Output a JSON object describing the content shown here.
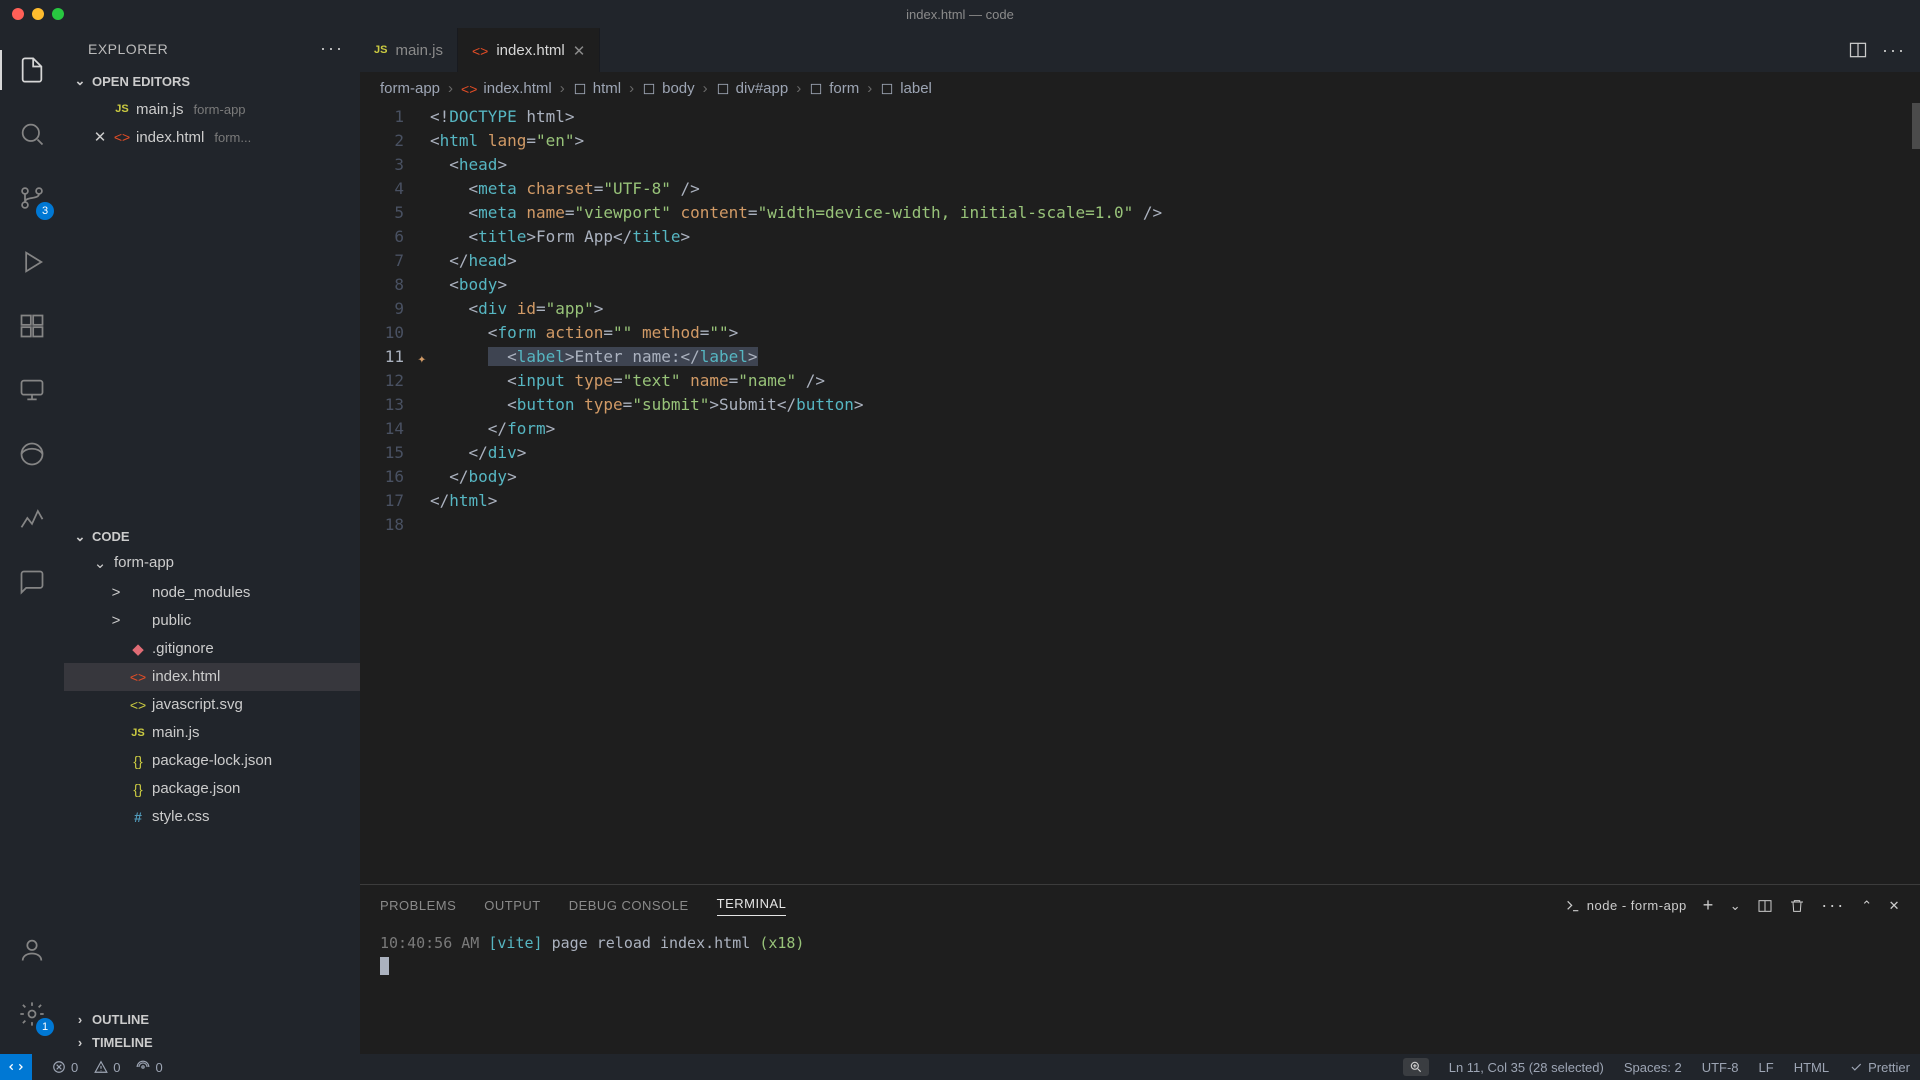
{
  "titlebar": {
    "title": "index.html — code"
  },
  "activity": {
    "scm_badge": "3",
    "accounts_badge": "1"
  },
  "sidebar": {
    "title": "EXPLORER",
    "sections": {
      "openEditors": "OPEN EDITORS",
      "workspace": "CODE",
      "outline": "OUTLINE",
      "timeline": "TIMELINE"
    },
    "openEditors": [
      {
        "icon": "js",
        "name": "main.js",
        "sub": "form-app"
      },
      {
        "icon": "html",
        "name": "index.html",
        "sub": "form...",
        "dirty": true
      }
    ],
    "folder": "form-app",
    "files": [
      {
        "chev": ">",
        "icon": "",
        "name": "node_modules",
        "depth": 2
      },
      {
        "chev": ">",
        "icon": "",
        "name": "public",
        "depth": 2
      },
      {
        "chev": "",
        "icon": "git",
        "name": ".gitignore",
        "depth": 2
      },
      {
        "chev": "",
        "icon": "html",
        "name": "index.html",
        "depth": 2,
        "selected": true
      },
      {
        "chev": "",
        "icon": "svg",
        "name": "javascript.svg",
        "depth": 2
      },
      {
        "chev": "",
        "icon": "js",
        "name": "main.js",
        "depth": 2
      },
      {
        "chev": "",
        "icon": "json",
        "name": "package-lock.json",
        "depth": 2
      },
      {
        "chev": "",
        "icon": "json",
        "name": "package.json",
        "depth": 2
      },
      {
        "chev": "",
        "icon": "css",
        "name": "style.css",
        "depth": 2
      }
    ]
  },
  "tabs": [
    {
      "icon": "js",
      "label": "main.js",
      "active": false
    },
    {
      "icon": "html",
      "label": "index.html",
      "active": true
    }
  ],
  "breadcrumbs": [
    "form-app",
    "index.html",
    "html",
    "body",
    "div#app",
    "form",
    "label"
  ],
  "code": {
    "lines": [
      {
        "n": 1,
        "html": "<span class='tok-punc'>&lt;!</span><span class='tok-doctype'>DOCTYPE</span> <span class='tok-doctype2'>html</span><span class='tok-punc'>&gt;</span>"
      },
      {
        "n": 2,
        "html": "<span class='tok-punc'>&lt;</span><span class='tok-tag'>html</span> <span class='tok-attr'>lang</span><span class='tok-punc'>=</span><span class='tok-str'>\"en\"</span><span class='tok-punc'>&gt;</span>"
      },
      {
        "n": 3,
        "html": "  <span class='tok-punc'>&lt;</span><span class='tok-tag'>head</span><span class='tok-punc'>&gt;</span>"
      },
      {
        "n": 4,
        "html": "    <span class='tok-punc'>&lt;</span><span class='tok-tag'>meta</span> <span class='tok-attr'>charset</span><span class='tok-punc'>=</span><span class='tok-str'>\"UTF-8\"</span> <span class='tok-punc'>/&gt;</span>"
      },
      {
        "n": 5,
        "html": "    <span class='tok-punc'>&lt;</span><span class='tok-tag'>meta</span> <span class='tok-attr'>name</span><span class='tok-punc'>=</span><span class='tok-str'>\"viewport\"</span> <span class='tok-attr'>content</span><span class='tok-punc'>=</span><span class='tok-str'>\"width=device-width, initial-scale=1.0\"</span> <span class='tok-punc'>/&gt;</span>"
      },
      {
        "n": 6,
        "html": "    <span class='tok-punc'>&lt;</span><span class='tok-tag'>title</span><span class='tok-punc'>&gt;</span><span class='tok-txt'>Form App</span><span class='tok-punc'>&lt;/</span><span class='tok-tag'>title</span><span class='tok-punc'>&gt;</span>"
      },
      {
        "n": 7,
        "html": "  <span class='tok-punc'>&lt;/</span><span class='tok-tag'>head</span><span class='tok-punc'>&gt;</span>"
      },
      {
        "n": 8,
        "html": "  <span class='tok-punc'>&lt;</span><span class='tok-tag'>body</span><span class='tok-punc'>&gt;</span>"
      },
      {
        "n": 9,
        "html": "    <span class='tok-punc'>&lt;</span><span class='tok-tag'>div</span> <span class='tok-attr'>id</span><span class='tok-punc'>=</span><span class='tok-str'>\"app\"</span><span class='tok-punc'>&gt;</span>"
      },
      {
        "n": 10,
        "html": "      <span class='tok-punc'>&lt;</span><span class='tok-tag'>form</span> <span class='tok-attr'>action</span><span class='tok-punc'>=</span><span class='tok-str'>\"\"</span> <span class='tok-attr'>method</span><span class='tok-punc'>=</span><span class='tok-str'>\"\"</span><span class='tok-punc'>&gt;</span>"
      },
      {
        "n": 11,
        "html": "      <span class='sel'>  <span class='tok-punc'>&lt;</span><span class='tok-tag'>label</span><span class='tok-punc'>&gt;</span><span class='tok-txt'>Enter name:</span><span class='tok-punc'>&lt;/</span><span class='tok-tag'>label</span><span class='tok-punc'>&gt;</span></span>",
        "active": true,
        "sparkle": true
      },
      {
        "n": 12,
        "html": "        <span class='tok-punc'>&lt;</span><span class='tok-tag'>input</span> <span class='tok-attr'>type</span><span class='tok-punc'>=</span><span class='tok-str'>\"text\"</span> <span class='tok-attr'>name</span><span class='tok-punc'>=</span><span class='tok-str'>\"name\"</span> <span class='tok-punc'>/&gt;</span>"
      },
      {
        "n": 13,
        "html": "        <span class='tok-punc'>&lt;</span><span class='tok-tag'>button</span> <span class='tok-attr'>type</span><span class='tok-punc'>=</span><span class='tok-str'>\"submit\"</span><span class='tok-punc'>&gt;</span><span class='tok-txt'>Submit</span><span class='tok-punc'>&lt;/</span><span class='tok-tag'>button</span><span class='tok-punc'>&gt;</span>"
      },
      {
        "n": 14,
        "html": "      <span class='tok-punc'>&lt;/</span><span class='tok-tag'>form</span><span class='tok-punc'>&gt;</span>"
      },
      {
        "n": 15,
        "html": "    <span class='tok-punc'>&lt;/</span><span class='tok-tag'>div</span><span class='tok-punc'>&gt;</span>"
      },
      {
        "n": 16,
        "html": "  <span class='tok-punc'>&lt;/</span><span class='tok-tag'>body</span><span class='tok-punc'>&gt;</span>"
      },
      {
        "n": 17,
        "html": "<span class='tok-punc'>&lt;/</span><span class='tok-tag'>html</span><span class='tok-punc'>&gt;</span>"
      },
      {
        "n": 18,
        "html": ""
      }
    ]
  },
  "panel": {
    "tabs": [
      "PROBLEMS",
      "OUTPUT",
      "DEBUG CONSOLE",
      "TERMINAL"
    ],
    "activeTab": 3,
    "terminal": {
      "process": "node - form-app",
      "time": "10:40:56 AM",
      "vite": "[vite]",
      "msg": "page reload",
      "file": "index.html",
      "count": "(x18)"
    }
  },
  "statusbar": {
    "errors": "0",
    "warnings": "0",
    "ports": "0",
    "cursor": "Ln 11, Col 35 (28 selected)",
    "spaces": "Spaces: 2",
    "encoding": "UTF-8",
    "eol": "LF",
    "lang": "HTML",
    "formatter": "Prettier"
  }
}
